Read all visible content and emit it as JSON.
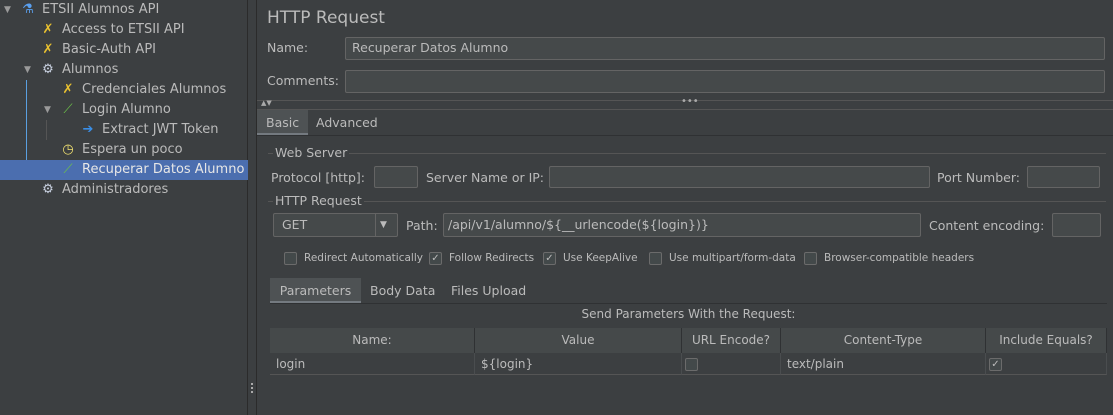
{
  "tree": {
    "items": [
      {
        "label": "ETSII Alumnos API",
        "icon": "flask-icon",
        "expanded": true
      },
      {
        "label": "Access to ETSII API",
        "icon": "wrench-screwdriver-icon"
      },
      {
        "label": "Basic-Auth API",
        "icon": "wrench-screwdriver-icon"
      },
      {
        "label": "Alumnos",
        "icon": "gear-icon",
        "expanded": true
      },
      {
        "label": "Credenciales Alumnos",
        "icon": "wrench-screwdriver-icon"
      },
      {
        "label": "Login Alumno",
        "icon": "pipette-icon",
        "expanded": true
      },
      {
        "label": "Extract JWT Token",
        "icon": "extractor-icon"
      },
      {
        "label": "Espera un poco",
        "icon": "timer-icon"
      },
      {
        "label": "Recuperar Datos Alumno",
        "icon": "pipette-icon",
        "selected": true
      },
      {
        "label": "Administradores",
        "icon": "gear-icon"
      }
    ]
  },
  "panel": {
    "title": "HTTP Request",
    "name_label": "Name:",
    "name_value": "Recuperar Datos Alumno",
    "comments_label": "Comments:",
    "comments_value": "",
    "tabs": [
      "Basic",
      "Advanced"
    ],
    "web_server": {
      "legend": "Web Server",
      "protocol_label": "Protocol [http]:",
      "protocol_value": "",
      "server_label": "Server Name or IP:",
      "server_value": "",
      "port_label": "Port Number:",
      "port_value": ""
    },
    "http_request": {
      "legend": "HTTP Request",
      "method": "GET",
      "path_label": "Path:",
      "path_value": "/api/v1/alumno/${__urlencode(${login})}",
      "encoding_label": "Content encoding:",
      "encoding_value": ""
    },
    "checkboxes": [
      {
        "label": "Redirect Automatically",
        "checked": false
      },
      {
        "label": "Follow Redirects",
        "checked": true
      },
      {
        "label": "Use KeepAlive",
        "checked": true
      },
      {
        "label": "Use multipart/form-data",
        "checked": false
      },
      {
        "label": "Browser-compatible headers",
        "checked": false
      }
    ],
    "subtabs": [
      "Parameters",
      "Body Data",
      "Files Upload"
    ],
    "params_caption": "Send Parameters With the Request:",
    "table": {
      "headers": [
        "Name:",
        "Value",
        "URL Encode?",
        "Content-Type",
        "Include Equals?"
      ],
      "rows": [
        {
          "name": "login",
          "value": "${login}",
          "url_encode": false,
          "content_type": "text/plain",
          "include_equals": true
        }
      ]
    }
  }
}
